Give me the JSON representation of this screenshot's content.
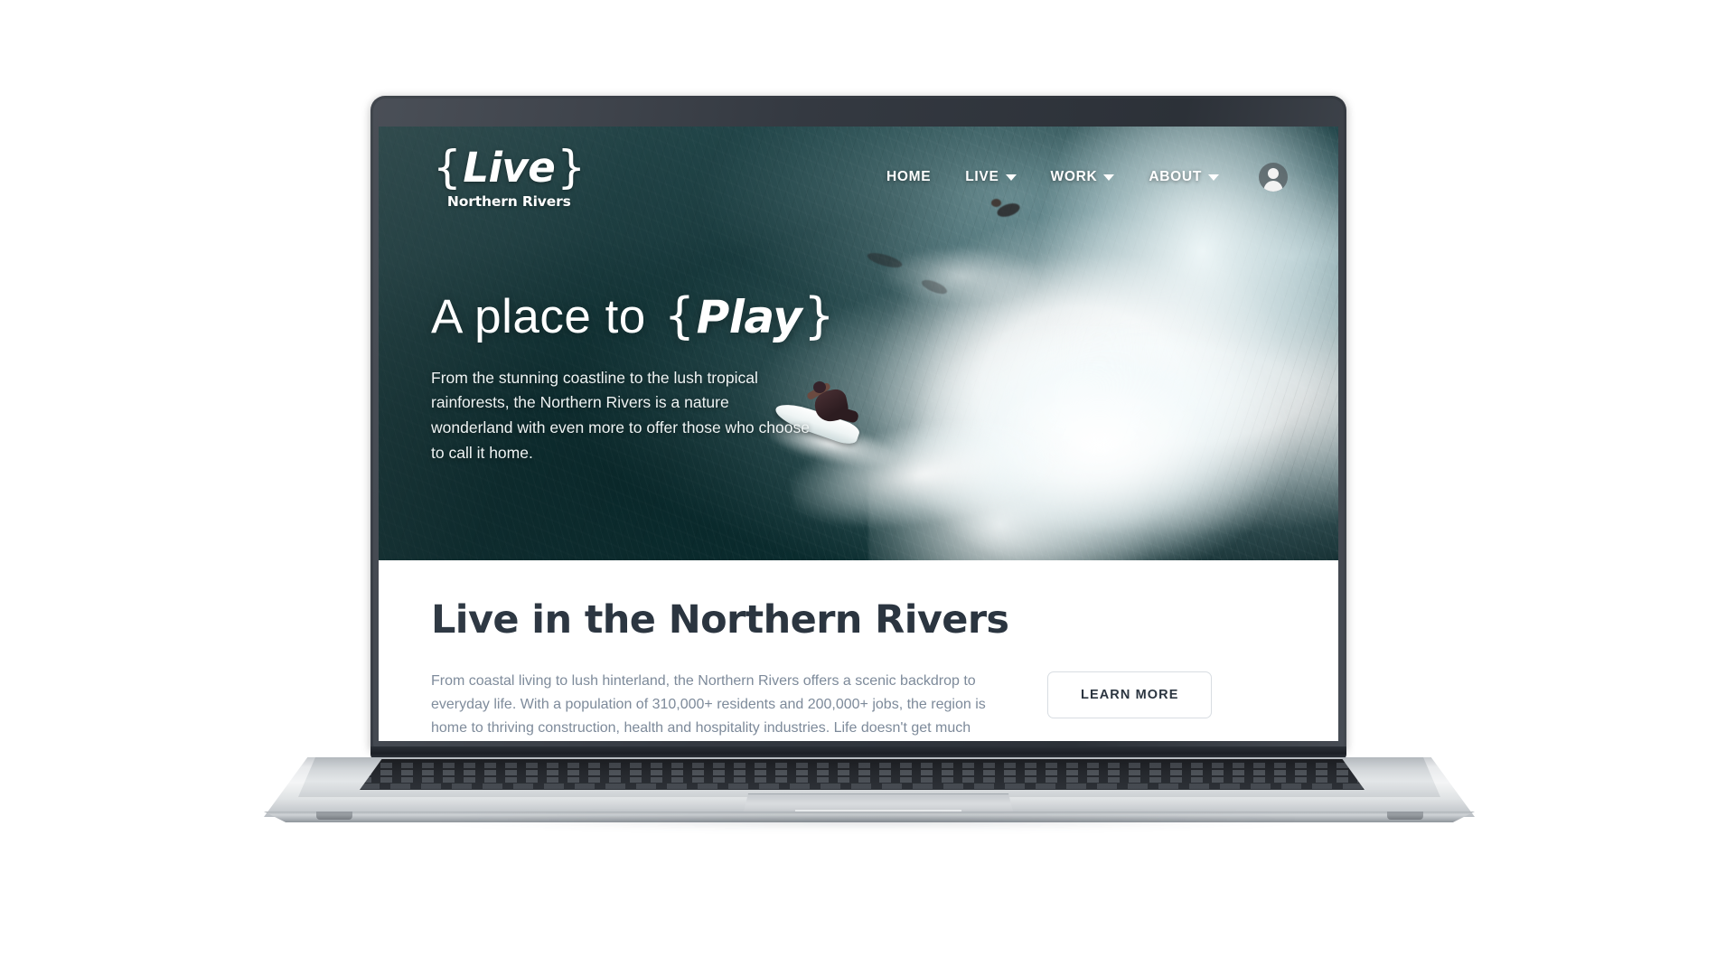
{
  "site": {
    "logo": {
      "word": "Live",
      "brace_open": "{",
      "brace_close": "}",
      "subtitle": "Northern Rivers"
    },
    "nav": {
      "items": [
        {
          "label": "HOME",
          "has_dropdown": false
        },
        {
          "label": "LIVE",
          "has_dropdown": true
        },
        {
          "label": "WORK",
          "has_dropdown": true
        },
        {
          "label": "ABOUT",
          "has_dropdown": true
        }
      ],
      "account_icon": "user-avatar-icon"
    }
  },
  "hero": {
    "heading_plain": "A place to",
    "heading_accent": "Play",
    "brace_open": "{",
    "brace_close": "}",
    "paragraph": "From the stunning coastline to the lush tropical rainforests, the Northern Rivers is a nature wonderland with even more to offer those who choose to call it home.",
    "background_image": "aerial-surfer-riding-wave-ocean"
  },
  "section": {
    "heading": "Live in the Northern Rivers",
    "paragraph": "From coastal living to lush hinterland, the Northern Rivers offers a scenic backdrop to everyday life. With a population of 310,000+ residents and 200,000+ jobs, the region is home to thriving construction, health and hospitality industries. Life doesn't get much better than kayaking the",
    "cta_label": "LEARN MORE"
  },
  "device": {
    "type": "laptop-mockup",
    "body_color": "#d4d8db",
    "bezel_color": "#343941"
  },
  "colors": {
    "heading": "#2b3540",
    "body_text": "#7d8a9a",
    "hero_text": "#ffffff",
    "button_border": "#d8dde2",
    "ocean_deep": "#0d282b",
    "ocean_mid": "#1d4044",
    "foam": "#ffffff",
    "page_background": "#ffffff"
  }
}
